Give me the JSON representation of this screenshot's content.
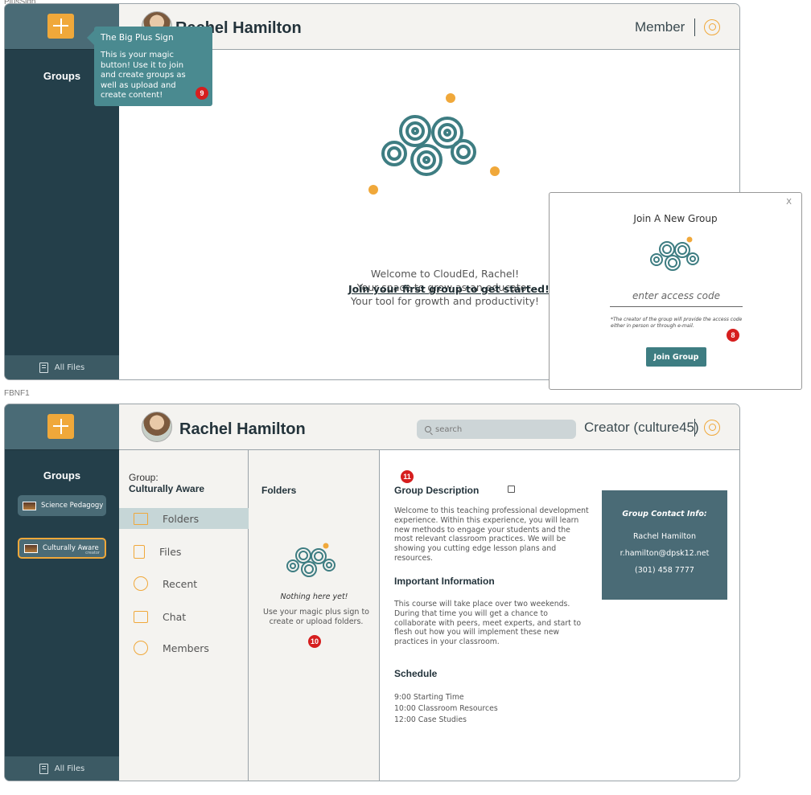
{
  "frame_labels": {
    "top": "PlusSign",
    "bottom": "FBNF1"
  },
  "frame1": {
    "sidebar": {
      "groups_title": "Groups",
      "all_files": "All Files"
    },
    "header": {
      "user_name": "Rachel Hamilton",
      "role": "Member"
    },
    "tooltip": {
      "title": "The Big Plus Sign",
      "body": "This is your magic button! Use it to join and create groups as well as upload and create content!",
      "marker": "9"
    },
    "welcome": {
      "line1": "Welcome to CloudEd, Rachel!",
      "line2": "Your space to grow as an educator.",
      "line3": "Your tool for growth and productivity!",
      "join_link": "Join your first group to get started!"
    },
    "modal": {
      "close": "X",
      "title": "Join A New Group",
      "input_placeholder": "enter access code",
      "note": "*The creator of the group will provide the access code either in person or through e-mail.",
      "marker": "8",
      "join_button": "Join Group"
    }
  },
  "frame2": {
    "sidebar": {
      "groups_title": "Groups",
      "groups": [
        {
          "name": "Science Pedagogy"
        },
        {
          "name": "Culturally Aware",
          "tag": "creator"
        }
      ],
      "all_files": "All Files"
    },
    "header": {
      "user_name": "Rachel Hamilton",
      "search_placeholder": "search",
      "role": "Creator (culture45)"
    },
    "nav": {
      "group_label": "Group:",
      "group_name": "Culturally Aware",
      "items": [
        {
          "label": "Folders",
          "icon": "folder-icon"
        },
        {
          "label": "Files",
          "icon": "file-icon"
        },
        {
          "label": "Recent",
          "icon": "clock-icon"
        },
        {
          "label": "Chat",
          "icon": "chat-icon"
        },
        {
          "label": "Members",
          "icon": "members-icon"
        }
      ]
    },
    "folders": {
      "title": "Folders",
      "empty_title": "Nothing here yet!",
      "empty_body": "Use your magic plus sign to create or upload folders.",
      "marker": "10"
    },
    "detail": {
      "marker": "11",
      "description_title": "Group Description",
      "description": "Welcome to this teaching professional development experience. Within this experience, you will learn new methods to engage your students and the most relevant classroom practices. We will be showing you cutting edge lesson plans and resources.",
      "info_title": "Important Information",
      "info": "This course will take place over two weekends. During that time you will get a chance to collaborate with peers, meet experts, and start to flesh out how you will implement these new practices in your classroom.",
      "schedule_title": "Schedule",
      "schedule": [
        "9:00   Starting Time",
        "10:00  Classroom Resources",
        "12:00  Case Studies"
      ]
    },
    "contact": {
      "title": "Group Contact Info:",
      "name": "Rachel Hamilton",
      "email": "r.hamilton@dpsk12.net",
      "phone": "(301) 458 7777"
    }
  },
  "colors": {
    "accent": "#f0a83a",
    "sidebar": "#243f4a",
    "teal": "#4a8a90",
    "marker": "#d61e1e"
  }
}
